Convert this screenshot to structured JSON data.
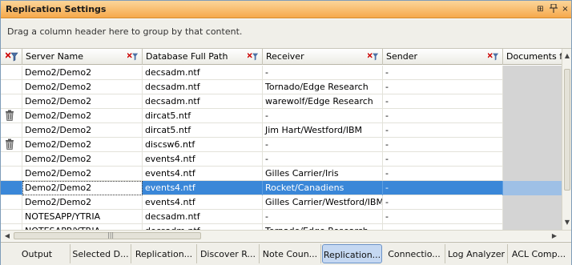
{
  "window": {
    "title": "Replication Settings",
    "pin_label": "⊞",
    "pushpin_label": "ᵽ",
    "close_label": "×"
  },
  "group_panel": {
    "text": "Drag a column header here to group by that content."
  },
  "columns": [
    {
      "label": ""
    },
    {
      "label": "Server Name"
    },
    {
      "label": "Database Full Path"
    },
    {
      "label": "Receiver"
    },
    {
      "label": "Sender"
    },
    {
      "label": "Documents f"
    }
  ],
  "rows": [
    {
      "trash": false,
      "server": "Demo2/Demo2",
      "db": "decsadm.ntf",
      "receiver": "-",
      "sender": "-",
      "selected": false
    },
    {
      "trash": false,
      "server": "Demo2/Demo2",
      "db": "decsadm.ntf",
      "receiver": "Tornado/Edge Research",
      "sender": "-",
      "selected": false
    },
    {
      "trash": false,
      "server": "Demo2/Demo2",
      "db": "decsadm.ntf",
      "receiver": "warewolf/Edge Research",
      "sender": "-",
      "selected": false
    },
    {
      "trash": true,
      "server": "Demo2/Demo2",
      "db": "dircat5.ntf",
      "receiver": "-",
      "sender": "-",
      "selected": false
    },
    {
      "trash": false,
      "server": "Demo2/Demo2",
      "db": "dircat5.ntf",
      "receiver": "Jim Hart/Westford/IBM",
      "sender": "-",
      "selected": false
    },
    {
      "trash": true,
      "server": "Demo2/Demo2",
      "db": "discsw6.ntf",
      "receiver": "-",
      "sender": "-",
      "selected": false
    },
    {
      "trash": false,
      "server": "Demo2/Demo2",
      "db": "events4.ntf",
      "receiver": "-",
      "sender": "-",
      "selected": false
    },
    {
      "trash": false,
      "server": "Demo2/Demo2",
      "db": "events4.ntf",
      "receiver": "Gilles Carrier/Iris",
      "sender": "-",
      "selected": false
    },
    {
      "trash": false,
      "server": "Demo2/Demo2",
      "db": "events4.ntf",
      "receiver": "Rocket/Canadiens",
      "sender": "-",
      "selected": true
    },
    {
      "trash": false,
      "server": "Demo2/Demo2",
      "db": "events4.ntf",
      "receiver": "Gilles Carrier/Westford/IBM",
      "sender": "-",
      "selected": false
    },
    {
      "trash": false,
      "server": "NOTESAPP/YTRIA",
      "db": "decsadm.ntf",
      "receiver": "-",
      "sender": "-",
      "selected": false
    },
    {
      "trash": false,
      "server": "NOTESAPP/YTRIA",
      "db": "decsadm.ntf",
      "receiver": "Tornado/Edge Research",
      "sender": "-",
      "selected": false
    }
  ],
  "tabs": [
    {
      "label": "Output",
      "active": false
    },
    {
      "label": "Selected D...",
      "active": false
    },
    {
      "label": "Replication...",
      "active": false
    },
    {
      "label": "Discover R...",
      "active": false
    },
    {
      "label": "Note Coun...",
      "active": false
    },
    {
      "label": "Replication...",
      "active": true
    },
    {
      "label": "Connectio...",
      "active": false
    },
    {
      "label": "Log Analyzer",
      "active": false
    },
    {
      "label": "ACL Comp...",
      "active": false
    }
  ],
  "colors": {
    "title_bar": "#f6a94b",
    "selection": "#3a87d8",
    "active_tab": "#c5d8f2"
  },
  "icons": {
    "filter": "funnel-icon",
    "delete": "trash-icon"
  }
}
